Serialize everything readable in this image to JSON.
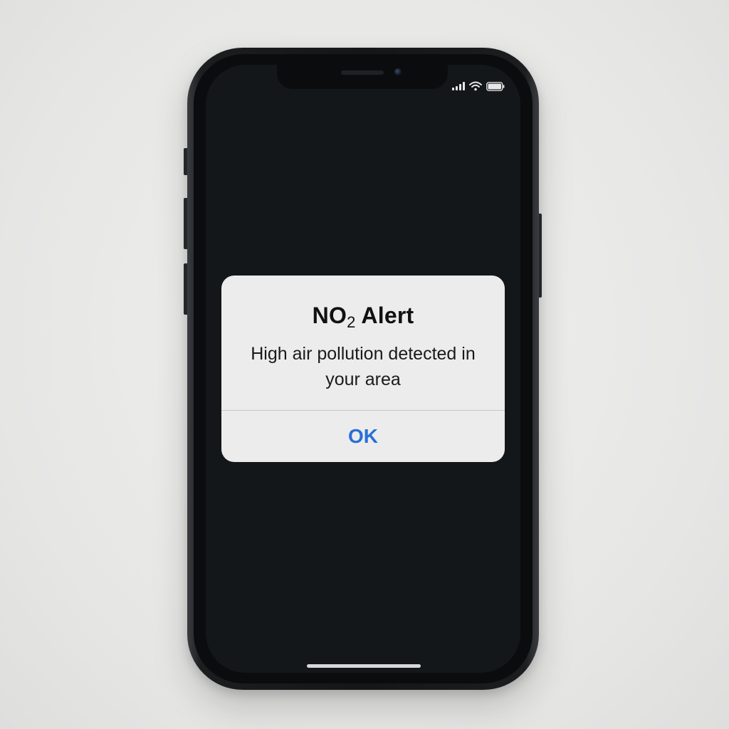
{
  "status_bar": {
    "signal_icon": "cellular-signal-icon",
    "wifi_icon": "wifi-icon",
    "battery_icon": "battery-icon"
  },
  "alert": {
    "title_main": "NO",
    "title_subscript": "2",
    "title_suffix": " Alert",
    "message": "High air pollution detected in your area",
    "ok_label": "OK"
  },
  "colors": {
    "accent": "#2a6fd6",
    "screen_background": "#14171a",
    "alert_background": "#ececec"
  }
}
